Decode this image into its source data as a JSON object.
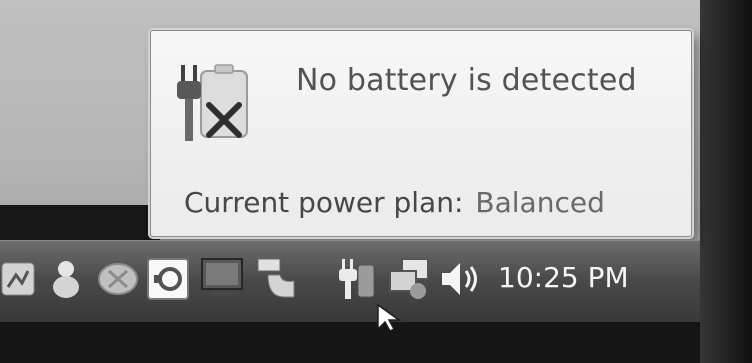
{
  "flyout": {
    "icon": "battery-plug-error-icon",
    "battery_status": "No battery is detected",
    "power_plan_label": "Current power plan:",
    "power_plan_value": "Balanced"
  },
  "taskbar": {
    "tray_icons": [
      "app-icon",
      "messenger-icon",
      "chat-icon",
      "app-window-icon",
      "monitor-icon",
      "device-icon",
      "power-plug-icon",
      "network-icon",
      "volume-icon"
    ],
    "clock": "10:25 PM"
  },
  "cursor": "mouse-pointer-icon"
}
